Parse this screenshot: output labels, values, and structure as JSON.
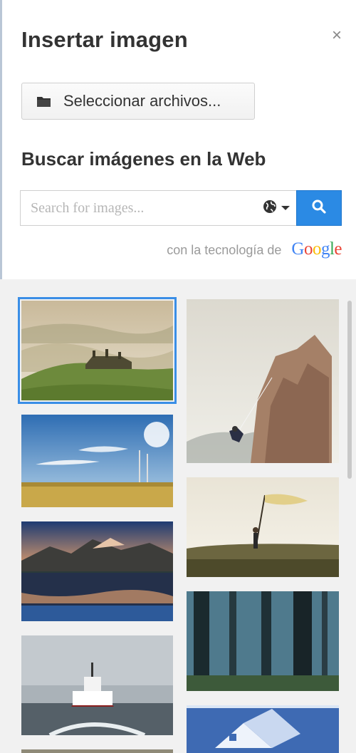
{
  "dialog": {
    "title": "Insertar imagen",
    "close_glyph": "×"
  },
  "upload": {
    "button_label": "Seleccionar archivos...",
    "icon": "folder-icon"
  },
  "web_search": {
    "section_title": "Buscar imágenes en la Web",
    "placeholder": "Search for images...",
    "value": "",
    "region_icon": "globe-icon",
    "search_icon": "search-icon",
    "powered_by_text": "con la tecnología de",
    "provider_logo": "Google"
  },
  "gallery": {
    "selected_index": 0,
    "images": [
      {
        "subject": "misty hills with castle"
      },
      {
        "subject": "climber on rock cliff"
      },
      {
        "subject": "wheat field blue sky"
      },
      {
        "subject": "person waving flag"
      },
      {
        "subject": "mountain lake reflection"
      },
      {
        "subject": "foggy forest"
      },
      {
        "subject": "ship at sea"
      },
      {
        "subject": "paper house illustration"
      },
      {
        "subject": "partial image"
      }
    ]
  },
  "colors": {
    "accent": "#2b8ae4",
    "selection": "#3a8ee6",
    "gallery_bg": "#f1f1f1",
    "google": [
      "#4285f4",
      "#ea4335",
      "#fbbc05",
      "#4285f4",
      "#34a853",
      "#ea4335"
    ]
  }
}
